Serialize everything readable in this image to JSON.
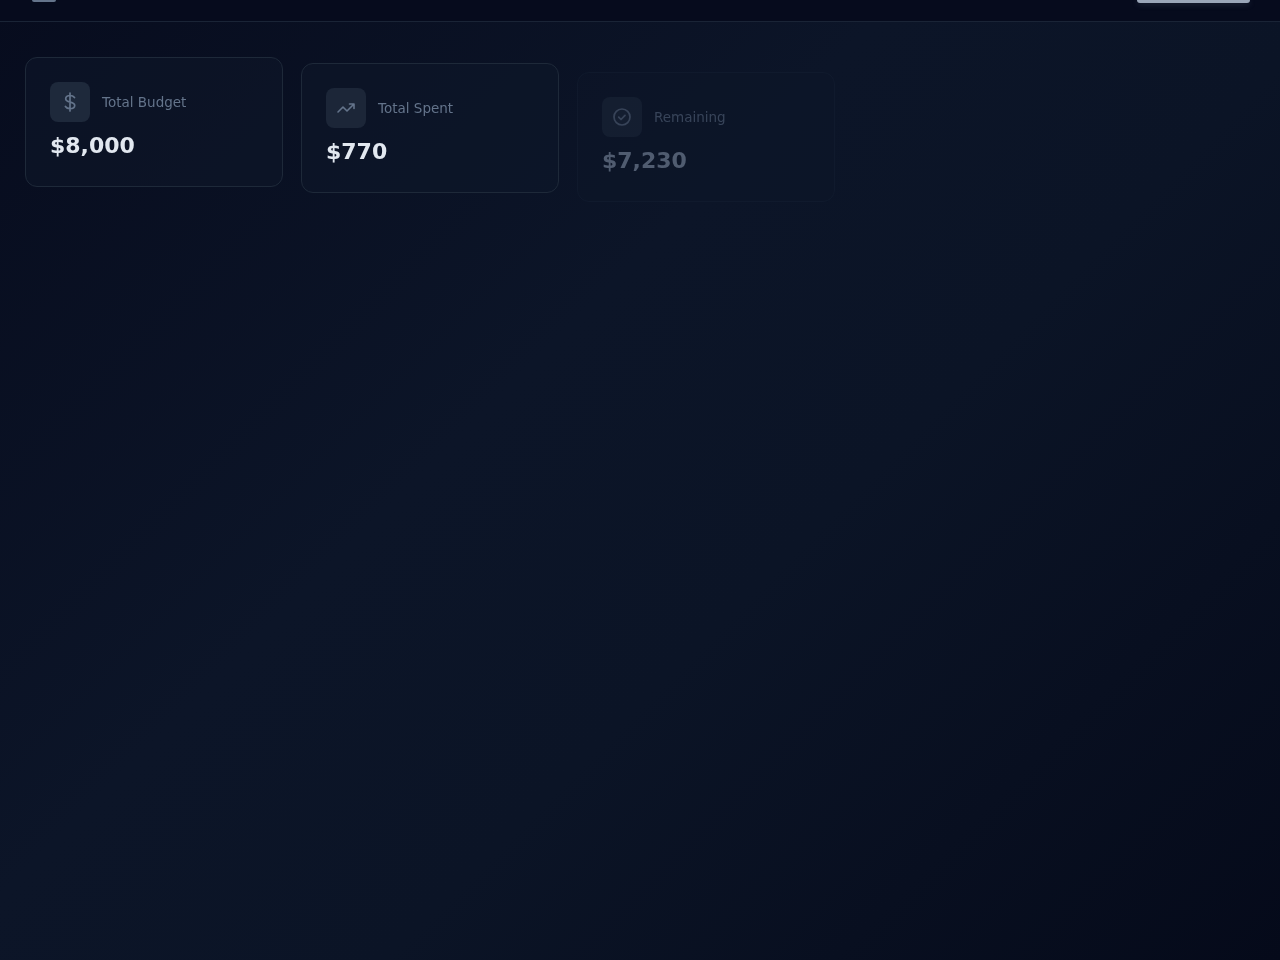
{
  "stats": [
    {
      "kind": "budget",
      "label": "Total Budget",
      "value": "$8,000"
    },
    {
      "kind": "spent",
      "label": "Total Spent",
      "value": "$770"
    },
    {
      "kind": "remaining",
      "label": "Remaining",
      "value": "$7,230"
    }
  ]
}
